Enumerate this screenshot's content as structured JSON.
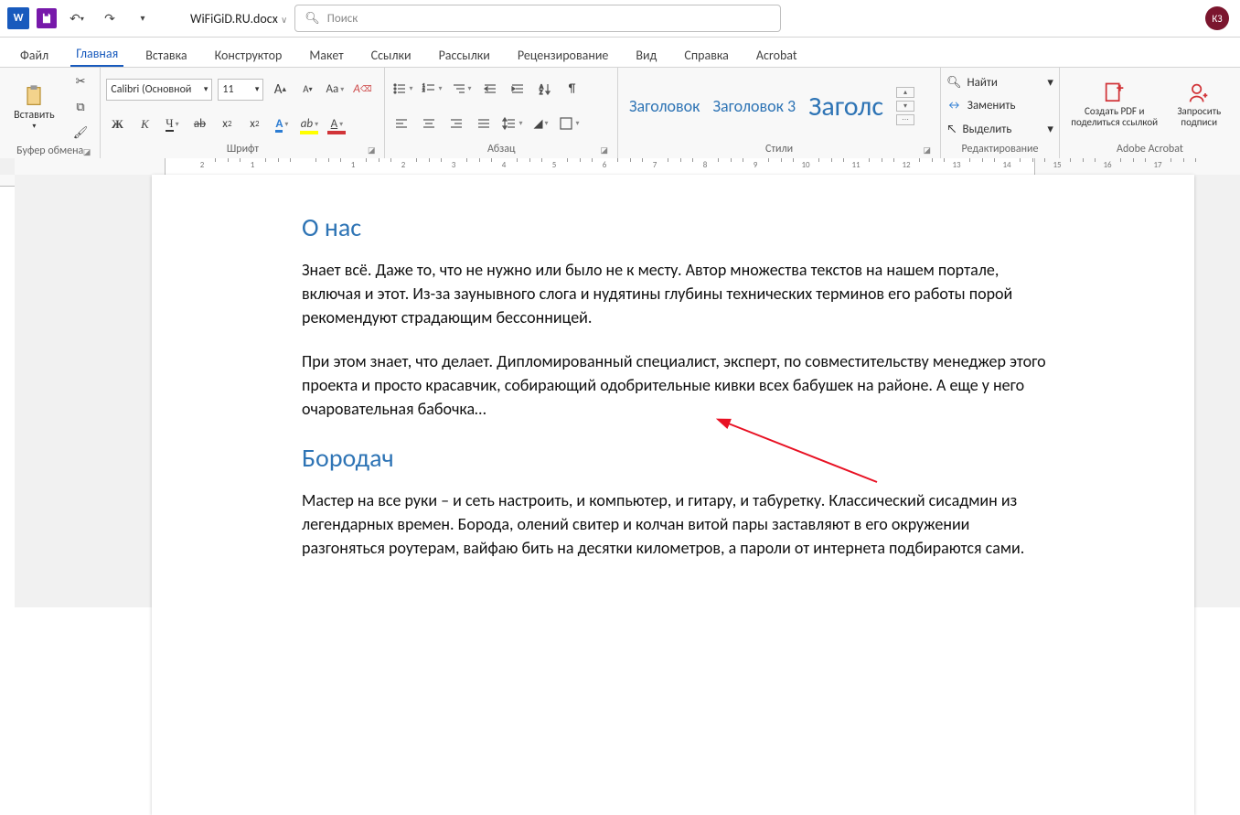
{
  "titlebar": {
    "doc_name": "WiFiGiD.RU.docx",
    "search_placeholder": "Поиск",
    "user_initials": "КЗ"
  },
  "tabs": {
    "file": "Файл",
    "home": "Главная",
    "insert": "Вставка",
    "design": "Конструктор",
    "layout": "Макет",
    "refs": "Ссылки",
    "mailings": "Рассылки",
    "review": "Рецензирование",
    "view": "Вид",
    "help": "Справка",
    "acrobat": "Acrobat"
  },
  "ribbon": {
    "clipboard": {
      "paste": "Вставить",
      "group": "Буфер обмена"
    },
    "font": {
      "name": "Calibri (Основной",
      "size": "11",
      "group": "Шрифт",
      "bold": "Ж",
      "italic": "К",
      "underline": "Ч",
      "strike": "ab",
      "sub": "x",
      "sup": "x",
      "Aa": "Aa",
      "effects": "A",
      "清": "A",
      "inc": "A",
      "dec": "A",
      "hl": "ab",
      "color": "A"
    },
    "para": {
      "group": "Абзац"
    },
    "styles": {
      "group": "Стили",
      "s1": "Заголовок",
      "s2": "Заголовок 3",
      "s3": "Заголс"
    },
    "editing": {
      "group": "Редактирование",
      "find": "Найти",
      "replace": "Заменить",
      "select": "Выделить"
    },
    "acrobat": {
      "group": "Adobe Acrobat",
      "share": "Создать PDF и поделиться ссылкой",
      "sign": "Запросить подписи"
    }
  },
  "document": {
    "h1": "О нас",
    "p1": "Знает всё. Даже то, что не нужно или было не к месту. Автор множества текстов на нашем портале, включая и этот. Из-за заунывного слога и нудятины глубины технических терминов его работы порой рекомендуют страдающим бессонницей.",
    "p2": "При этом знает, что делает. Дипломированный специалист, эксперт, по совместительству менеджер этого проекта и просто красавчик, собирающий одобрительные кивки всех бабушек на районе. А еще у него очаровательная бабочка…",
    "h2": "Бородач",
    "p3": "Мастер на все руки – и сеть настроить, и компьютер, и гитару, и табуретку. Классический сисадмин из легендарных времен. Борода, олений свитер и колчан витой пары заставляют в его окружении разгоняться роутерам, вайфаю бить на десятки километров, а пароли от интернета подбираются сами."
  },
  "ruler_numbers": [
    "1",
    "2",
    "1",
    "2",
    "3",
    "4",
    "5",
    "6",
    "7",
    "8",
    "9",
    "10",
    "11",
    "12",
    "13",
    "14",
    "15",
    "16"
  ]
}
